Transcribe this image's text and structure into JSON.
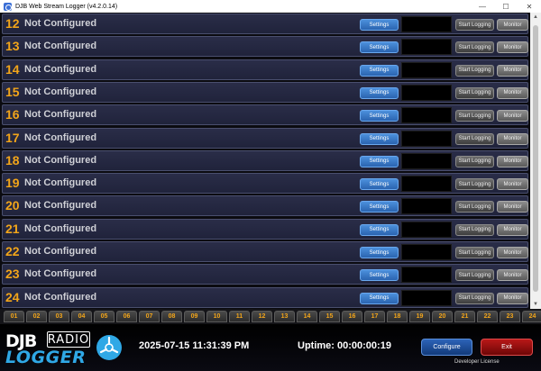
{
  "window": {
    "title": "DJB Web Stream Logger (v4.2.0.14)",
    "minimize": "—",
    "maximize": "☐",
    "close": "✕"
  },
  "channels": [
    {
      "number": "12",
      "status": "Not Configured",
      "settings_label": "Settings",
      "log_label": "Start Logging",
      "monitor_label": "Monitor"
    },
    {
      "number": "13",
      "status": "Not Configured",
      "settings_label": "Settings",
      "log_label": "Start Logging",
      "monitor_label": "Monitor"
    },
    {
      "number": "14",
      "status": "Not Configured",
      "settings_label": "Settings",
      "log_label": "Start Logging",
      "monitor_label": "Monitor"
    },
    {
      "number": "15",
      "status": "Not Configured",
      "settings_label": "Settings",
      "log_label": "Start Logging",
      "monitor_label": "Monitor"
    },
    {
      "number": "16",
      "status": "Not Configured",
      "settings_label": "Settings",
      "log_label": "Start Logging",
      "monitor_label": "Monitor"
    },
    {
      "number": "17",
      "status": "Not Configured",
      "settings_label": "Settings",
      "log_label": "Start Logging",
      "monitor_label": "Monitor"
    },
    {
      "number": "18",
      "status": "Not Configured",
      "settings_label": "Settings",
      "log_label": "Start Logging",
      "monitor_label": "Monitor"
    },
    {
      "number": "19",
      "status": "Not Configured",
      "settings_label": "Settings",
      "log_label": "Start Logging",
      "monitor_label": "Monitor"
    },
    {
      "number": "20",
      "status": "Not Configured",
      "settings_label": "Settings",
      "log_label": "Start Logging",
      "monitor_label": "Monitor"
    },
    {
      "number": "21",
      "status": "Not Configured",
      "settings_label": "Settings",
      "log_label": "Start Logging",
      "monitor_label": "Monitor"
    },
    {
      "number": "22",
      "status": "Not Configured",
      "settings_label": "Settings",
      "log_label": "Start Logging",
      "monitor_label": "Monitor"
    },
    {
      "number": "23",
      "status": "Not Configured",
      "settings_label": "Settings",
      "log_label": "Start Logging",
      "monitor_label": "Monitor"
    },
    {
      "number": "24",
      "status": "Not Configured",
      "settings_label": "Settings",
      "log_label": "Start Logging",
      "monitor_label": "Monitor"
    }
  ],
  "tabs": [
    "01",
    "02",
    "03",
    "04",
    "05",
    "06",
    "07",
    "08",
    "09",
    "10",
    "11",
    "12",
    "13",
    "14",
    "15",
    "16",
    "17",
    "18",
    "19",
    "20",
    "21",
    "22",
    "23",
    "24"
  ],
  "footer": {
    "logo_djb": "DJB",
    "logo_radio": "RADIO",
    "logo_logger": "LOGGER",
    "datetime": "2025-07-15 11:31:39 PM",
    "uptime": "Uptime: 00:00:00:19",
    "configure_label": "Configure",
    "exit_label": "Exit",
    "license": "Developer License"
  },
  "scrollbar": {
    "up": "▲",
    "down": "▼"
  },
  "colors": {
    "accent_number": "#f2a51a",
    "settings_button": "#2a64b0",
    "exit_button": "#b81818",
    "logo_blue": "#2fa8e6"
  }
}
